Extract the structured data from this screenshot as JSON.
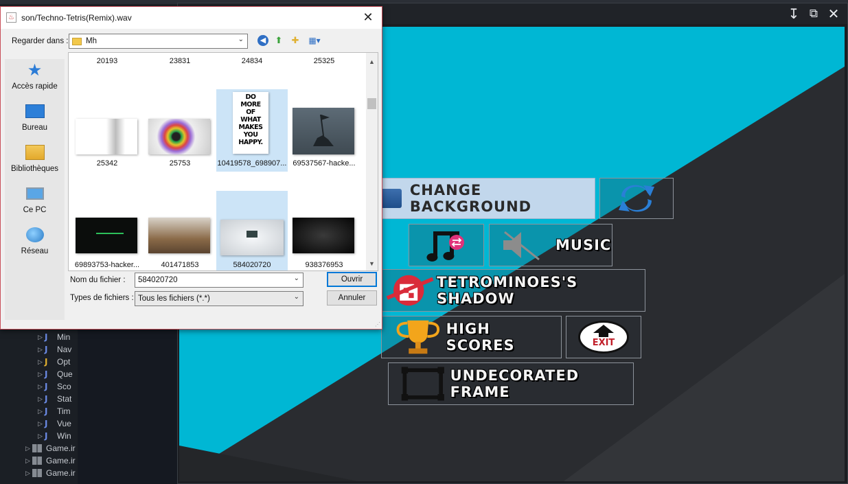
{
  "ide": {
    "tree_items": [
      {
        "label": "Min",
        "icon": "java-file-icon"
      },
      {
        "label": "Nav",
        "icon": "java-file-icon"
      },
      {
        "label": "Opt",
        "icon": "java-file-warning-icon"
      },
      {
        "label": "Que",
        "icon": "java-file-icon"
      },
      {
        "label": "Sco",
        "icon": "java-file-icon"
      },
      {
        "label": "Stat",
        "icon": "java-file-icon"
      },
      {
        "label": "Tim",
        "icon": "java-file-icon"
      },
      {
        "label": "Vue",
        "icon": "java-file-icon"
      },
      {
        "label": "Win",
        "icon": "java-file-icon"
      }
    ],
    "packages": [
      {
        "label": "Game.ir"
      },
      {
        "label": "Game.ir"
      },
      {
        "label": "Game.ir"
      }
    ]
  },
  "game_window": {
    "controls": {
      "minimize": "↧",
      "maximize": "⧉",
      "close": "✕"
    },
    "colors": {
      "accent": "#00b7d4",
      "dark": "#2a2c30"
    },
    "buttons": {
      "change_background": "CHANGE BACKGROUND",
      "music": "MUSIC",
      "tetrominoes_shadow": "TETROMINOES'S SHADOW",
      "high_scores": "HIGH SCORES",
      "exit": "EXIT",
      "undecorated_frame": "UNDECORATED FRAME"
    }
  },
  "dialog": {
    "title": "son/Techno-Tetris(Remix).wav",
    "look_in_label": "Regarder dans :",
    "look_in_value": "Mh",
    "places": [
      {
        "label": "Accès rapide",
        "icon": "star-icon"
      },
      {
        "label": "Bureau",
        "icon": "desktop-icon"
      },
      {
        "label": "Bibliothèques",
        "icon": "libraries-icon"
      },
      {
        "label": "Ce PC",
        "icon": "computer-icon"
      },
      {
        "label": "Réseau",
        "icon": "network-icon"
      }
    ],
    "files_top_row": [
      "20193",
      "23831",
      "24834",
      "25325"
    ],
    "files_row2": [
      "25342",
      "25753",
      "10419578_698907...",
      "69537567-hacke..."
    ],
    "files_row3": [
      "69893753-hacker...",
      "401471853",
      "584020720",
      "938376953"
    ],
    "quote_text": [
      "DO",
      "MORE",
      "OF",
      "WHAT",
      "MAKES",
      "YOU",
      "HAPPY."
    ],
    "filename_label": "Nom du fichier :",
    "filename_value": "584020720",
    "filetype_label": "Types de fichiers :",
    "filetype_value": "Tous les fichiers (*.*)",
    "open_button": "Ouvrir",
    "cancel_button": "Annuler"
  }
}
